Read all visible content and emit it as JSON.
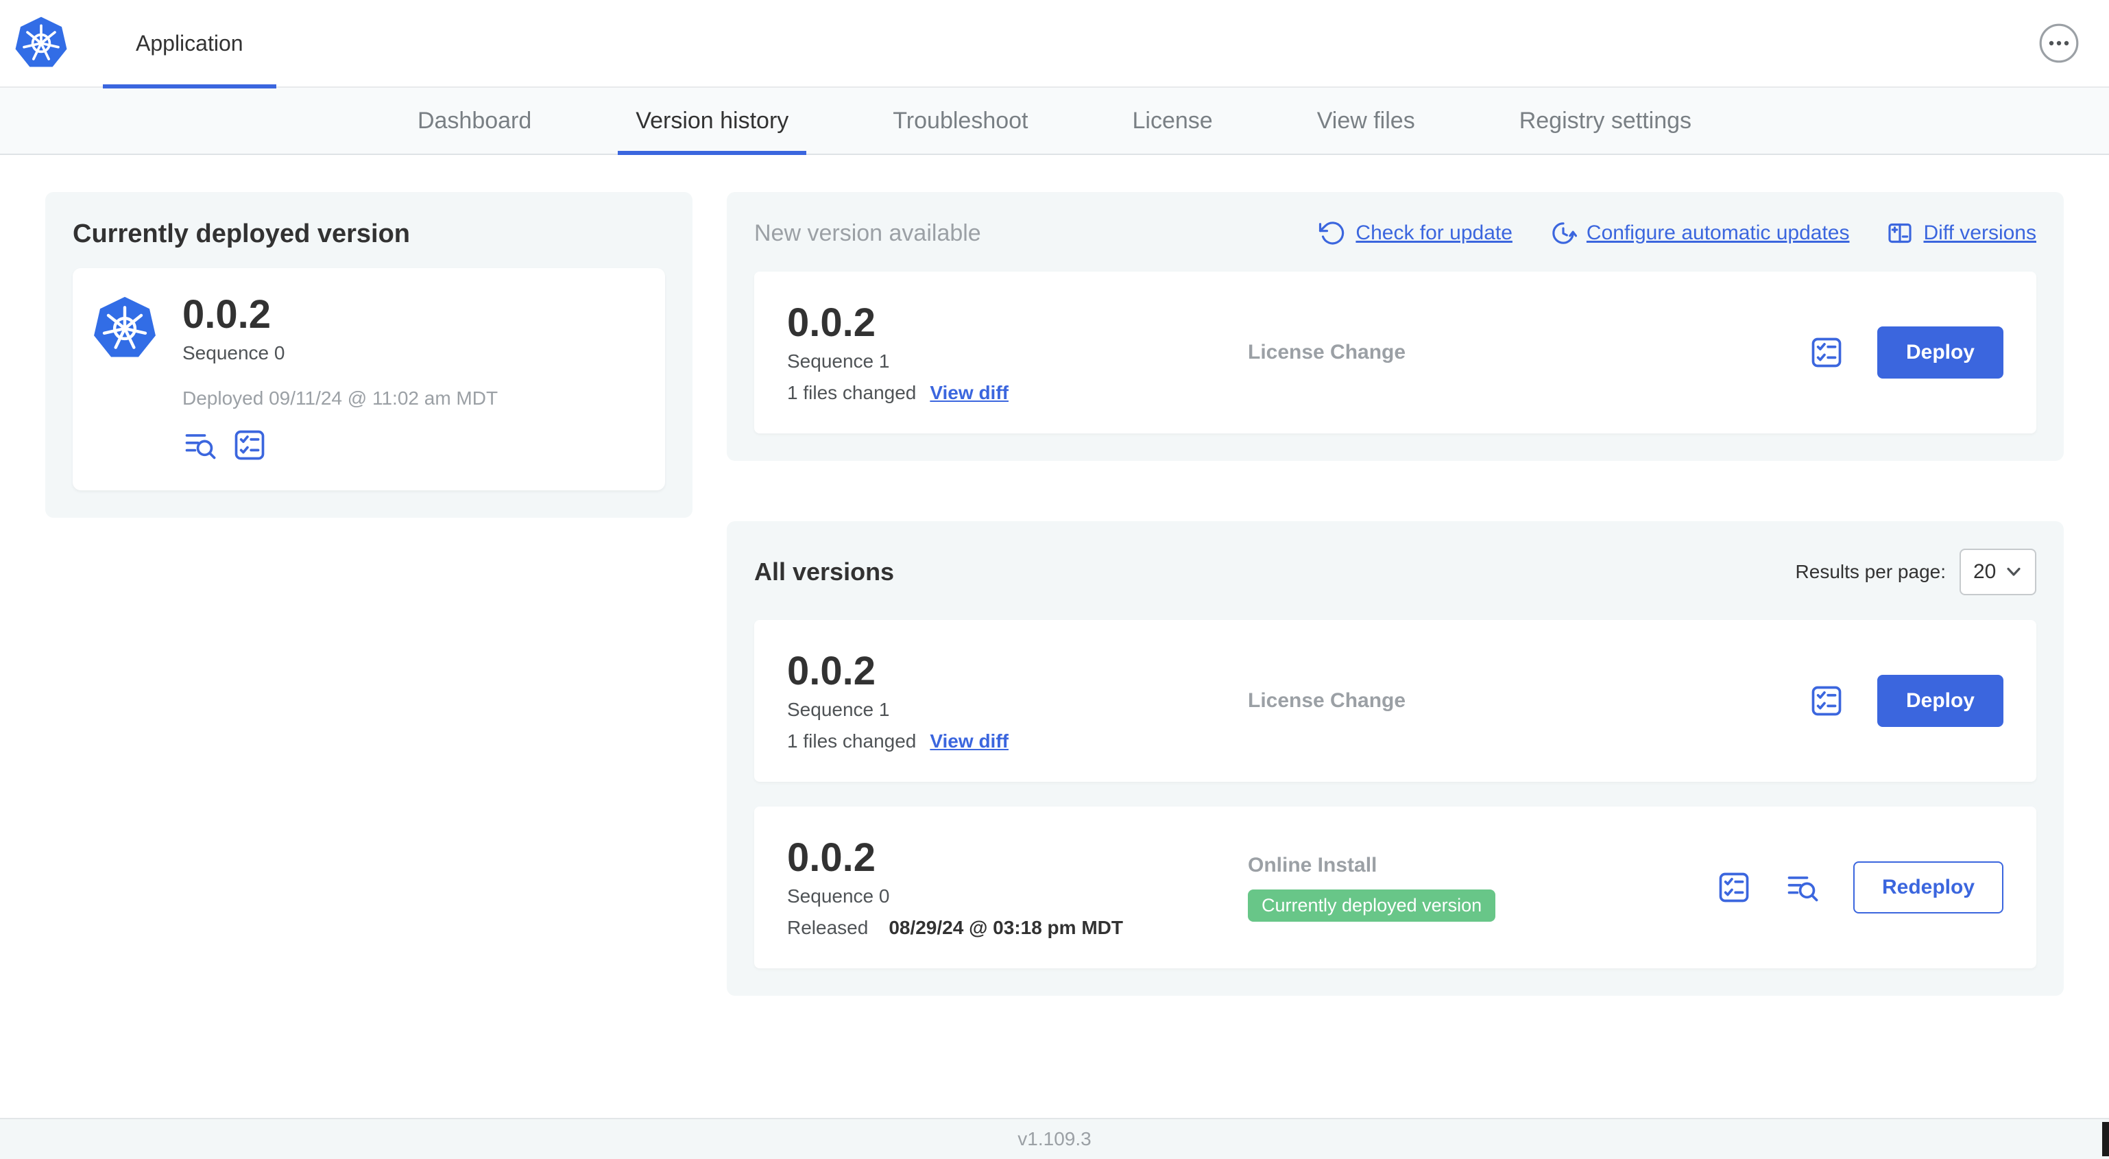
{
  "header": {
    "app_tab": "Application"
  },
  "nav": {
    "tabs": [
      {
        "label": "Dashboard",
        "active": false
      },
      {
        "label": "Version history",
        "active": true
      },
      {
        "label": "Troubleshoot",
        "active": false
      },
      {
        "label": "License",
        "active": false
      },
      {
        "label": "View files",
        "active": false
      },
      {
        "label": "Registry settings",
        "active": false
      }
    ]
  },
  "current_version_card": {
    "title": "Currently deployed version",
    "version": "0.0.2",
    "sequence": "Sequence 0",
    "deployed": "Deployed 09/11/24 @ 11:02 am MDT"
  },
  "new_version_card": {
    "title": "New version available",
    "actions": [
      {
        "label": "Check for update",
        "icon": "refresh-icon"
      },
      {
        "label": "Configure automatic updates",
        "icon": "schedule-clock-icon"
      },
      {
        "label": "Diff versions",
        "icon": "diff-columns-icon"
      }
    ],
    "row": {
      "version": "0.0.2",
      "sequence": "Sequence 1",
      "files_changed": "1 files changed",
      "view_diff": "View diff",
      "source": "License Change",
      "button": "Deploy"
    }
  },
  "all_versions_card": {
    "title": "All versions",
    "results_per_page_label": "Results per page:",
    "results_per_page_value": "20",
    "rows": [
      {
        "version": "0.0.2",
        "sequence": "Sequence 1",
        "files_changed": "1 files changed",
        "view_diff": "View diff",
        "source": "License Change",
        "button": "Deploy"
      },
      {
        "version": "0.0.2",
        "sequence": "Sequence 0",
        "released_prefix": "Released",
        "released_date": "08/29/24 @ 03:18 pm MDT",
        "source": "Online Install",
        "badge": "Currently deployed version",
        "button": "Redeploy"
      }
    ]
  },
  "footer": {
    "version": "v1.109.3"
  },
  "colors": {
    "accent_blue": "#3b66de",
    "k8s_logo_blue": "#326de6",
    "badge_green": "#68c688",
    "text_dark": "#323232",
    "text_gray": "#9ba0a5",
    "card_bg": "#f3f7f8"
  },
  "icons": {
    "app_logo": "kubernetes-logo",
    "menu": "ellipsis-menu-icon",
    "check_update": "refresh-icon",
    "auto_updates": "schedule-clock-icon",
    "diff": "diff-columns-icon",
    "checklist": "checklist-icon",
    "logs": "log-search-icon",
    "select_chevron": "chevron-down-icon"
  }
}
